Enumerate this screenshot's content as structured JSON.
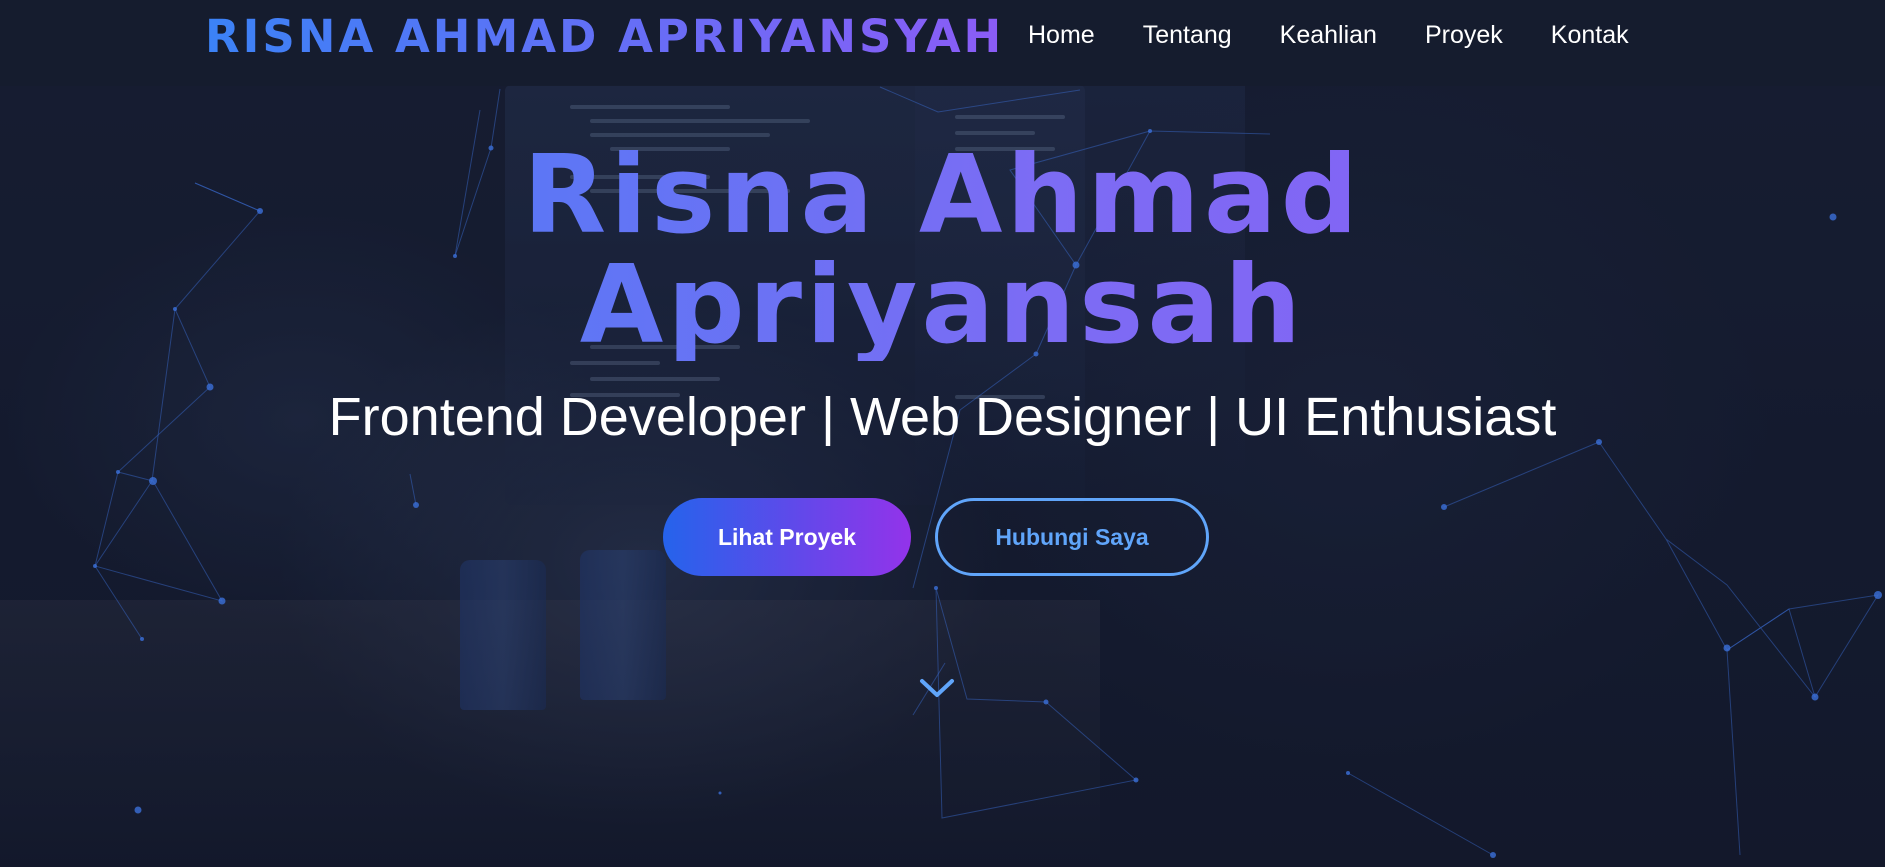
{
  "navbar": {
    "brand": "RISNA AHMAD APRIYANSYAH",
    "links": [
      {
        "label": "Home"
      },
      {
        "label": "Tentang"
      },
      {
        "label": "Keahlian"
      },
      {
        "label": "Proyek"
      },
      {
        "label": "Kontak"
      }
    ]
  },
  "hero": {
    "title_line1": "Risna Ahmad",
    "title_line2": "Apriyansah",
    "subtitle": "Frontend Developer | Web Designer | UI Enthusiast",
    "primary_button": "Lihat Proyek",
    "secondary_button": "Hubungi Saya",
    "scroll_icon": "chevron-down-icon"
  },
  "colors": {
    "accent_blue": "#3b82f6",
    "accent_purple": "#8b5cf6",
    "outline_blue": "#60a5fa",
    "background": "#151b2e"
  }
}
